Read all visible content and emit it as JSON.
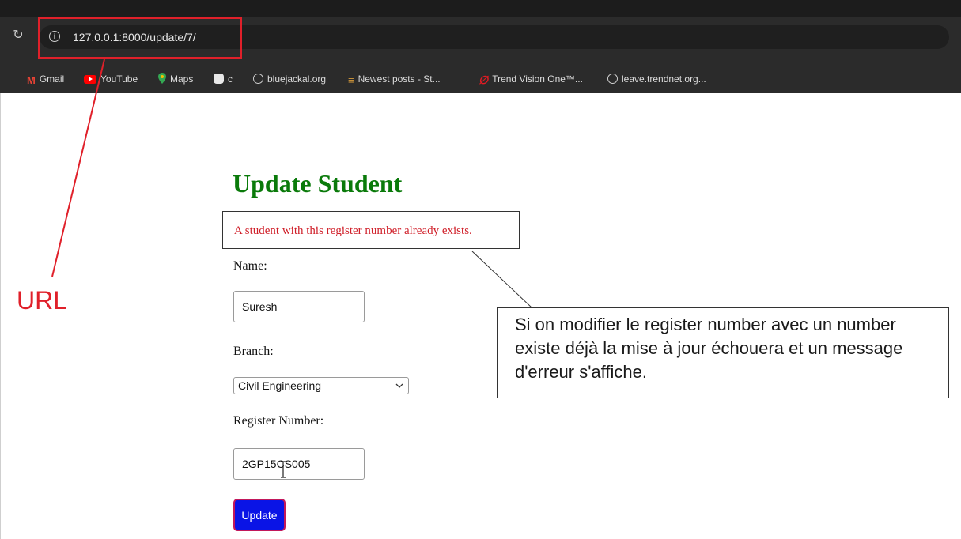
{
  "browser": {
    "url": "127.0.0.1:8000/update/7/",
    "bookmarks": [
      {
        "label": "Gmail",
        "icon": "gmail-icon"
      },
      {
        "label": "YouTube",
        "icon": "youtube-icon"
      },
      {
        "label": "Maps",
        "icon": "maps-icon"
      },
      {
        "label": "c",
        "icon": "bookmark-icon"
      },
      {
        "label": "bluejackal.org",
        "icon": "globe-icon"
      },
      {
        "label": "Newest posts - St...",
        "icon": "stack-icon"
      },
      {
        "label": "Trend Vision One™...",
        "icon": "trend-icon"
      },
      {
        "label": "leave.trendnet.org...",
        "icon": "globe-icon"
      }
    ]
  },
  "form": {
    "title": "Update Student",
    "error": "A student with this register number already exists.",
    "name_label": "Name:",
    "name_value": "Suresh",
    "branch_label": "Branch:",
    "branch_value": "Civil Engineering",
    "register_label": "Register Number:",
    "register_value": "2GP15CS005",
    "submit_label": "Update"
  },
  "annotations": {
    "url_label": "URL",
    "callout": "Si on modifier le register number avec un number existe déjà la mise à jour échouera et un message d'erreur s'affiche.",
    "color": "#e0202a"
  },
  "colors": {
    "title": "#0a7a0a",
    "error": "#d0202a",
    "button_bg": "#0a14e6",
    "button_border": "#c2185b"
  }
}
